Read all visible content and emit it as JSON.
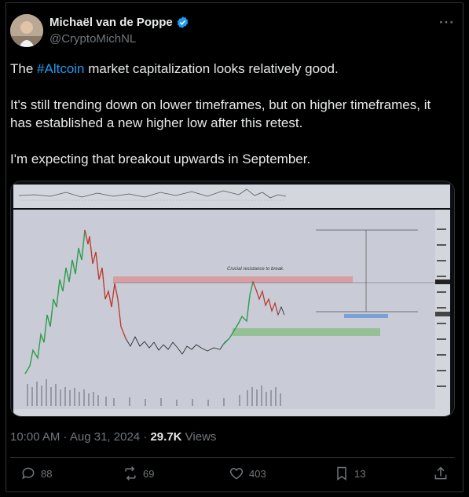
{
  "author": {
    "name": "Michaël van de Poppe",
    "handle": "@CryptoMichNL",
    "verified_icon": "verified-badge-icon",
    "verified_color": "#1d9bf0"
  },
  "tweet": {
    "line1_pre": "The ",
    "hashtag": "#Altcoin",
    "line1_post": " market capitalization looks relatively good.",
    "paragraph2": "It's still trending down on lower timeframes, but on higher timeframes, it has established a new higher low after this retest.",
    "paragraph3": "I'm expecting that breakout upwards in September."
  },
  "chart": {
    "annotation": "Crucial resistance to break.",
    "resistance_color": "#d9959a",
    "support_color": "#8fbf8f",
    "background": "#c9ccd6"
  },
  "meta": {
    "time": "10:00 AM · Aug 31, 2024 · ",
    "views_count": "29.7K",
    "views_label": " Views"
  },
  "actions": {
    "replies": "88",
    "reposts": "69",
    "likes": "403",
    "bookmarks": "13"
  }
}
